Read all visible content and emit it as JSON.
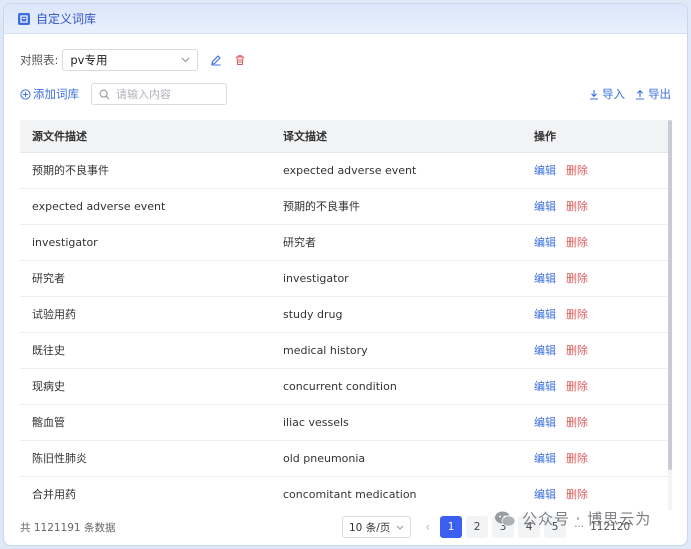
{
  "window": {
    "title": "自定义词库"
  },
  "toolbar": {
    "compare_label": "对照表:",
    "compare_value": "pv专用",
    "add_label": "添加词库",
    "search_placeholder": "请输入内容",
    "import_label": "导入",
    "export_label": "导出"
  },
  "table": {
    "headers": [
      "源文件描述",
      "译文描述",
      "操作"
    ],
    "rows": [
      {
        "source": "预期的不良事件",
        "target": "expected adverse event",
        "edit": "编辑",
        "delete": "删除"
      },
      {
        "source": "expected adverse event",
        "target": "预期的不良事件",
        "edit": "编辑",
        "delete": "删除"
      },
      {
        "source": "investigator",
        "target": "研究者",
        "edit": "编辑",
        "delete": "删除"
      },
      {
        "source": "研究者",
        "target": "investigator",
        "edit": "编辑",
        "delete": "删除"
      },
      {
        "source": "试验用药",
        "target": "study drug",
        "edit": "编辑",
        "delete": "删除"
      },
      {
        "source": "既往史",
        "target": "medical history",
        "edit": "编辑",
        "delete": "删除"
      },
      {
        "source": "现病史",
        "target": "concurrent condition",
        "edit": "编辑",
        "delete": "删除"
      },
      {
        "source": "髂血管",
        "target": "iliac vessels",
        "edit": "编辑",
        "delete": "删除"
      },
      {
        "source": "陈旧性肺炎",
        "target": "old pneumonia",
        "edit": "编辑",
        "delete": "删除"
      },
      {
        "source": "合并用药",
        "target": "concomitant medication",
        "edit": "编辑",
        "delete": "删除"
      }
    ]
  },
  "footer": {
    "total_text": "共 1121191 条数据",
    "page_size": "10 条/页",
    "pages": [
      "1",
      "2",
      "3",
      "4",
      "5"
    ],
    "current_page": "1",
    "ellipsis": "···",
    "last_page": "112120"
  },
  "watermark": {
    "text": "公众号 · 博思云为"
  },
  "colors": {
    "accent": "#3b6fe0",
    "danger": "#e05b5b",
    "active_page": "#3b5ff0"
  }
}
